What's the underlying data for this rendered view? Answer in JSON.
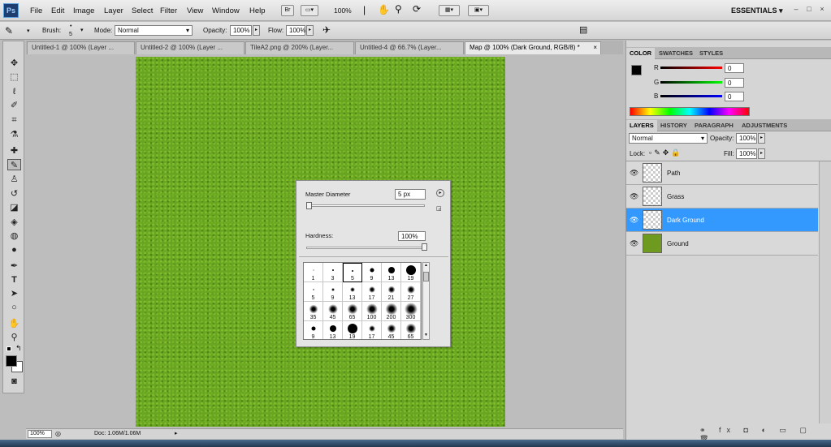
{
  "app": {
    "logo": "Ps",
    "menus": [
      "File",
      "Edit",
      "Image",
      "Layer",
      "Select",
      "Filter",
      "View",
      "Window",
      "Help"
    ],
    "br_label": "Br",
    "zoom": "100%",
    "workspace": "ESSENTIALS",
    "win_min": "–",
    "win_max": "□",
    "win_close": "×"
  },
  "options": {
    "brush_label": "Brush:",
    "brush_size": "5",
    "mode_label": "Mode:",
    "mode_value": "Normal",
    "opacity_label": "Opacity:",
    "opacity_value": "100%",
    "flow_label": "Flow:",
    "flow_value": "100%"
  },
  "tabs": [
    {
      "label": "Untitled-1 @ 100% (Layer ..."
    },
    {
      "label": "Untitled-2 @ 100% (Layer ..."
    },
    {
      "label": "TileA2.png @ 200% (Layer..."
    },
    {
      "label": "Untitled-4 @ 66.7% (Layer..."
    },
    {
      "label": "Map @ 100% (Dark Ground, RGB/8) *"
    }
  ],
  "brush_popup": {
    "master_label": "Master Diameter",
    "master_value": "5 px",
    "hardness_label": "Hardness:",
    "hardness_value": "100%",
    "presets": [
      {
        "n": "1",
        "d": 1,
        "soft": false
      },
      {
        "n": "3",
        "d": 2,
        "soft": false
      },
      {
        "n": "5",
        "d": 2,
        "soft": false
      },
      {
        "n": "9",
        "d": 5,
        "soft": false
      },
      {
        "n": "13",
        "d": 8,
        "soft": false
      },
      {
        "n": "19",
        "d": 12,
        "soft": false
      },
      {
        "n": "5",
        "d": 2,
        "soft": true
      },
      {
        "n": "9",
        "d": 4,
        "soft": true
      },
      {
        "n": "13",
        "d": 6,
        "soft": true
      },
      {
        "n": "17",
        "d": 8,
        "soft": true
      },
      {
        "n": "21",
        "d": 9,
        "soft": true
      },
      {
        "n": "27",
        "d": 10,
        "soft": true
      },
      {
        "n": "35",
        "d": 11,
        "soft": true
      },
      {
        "n": "45",
        "d": 12,
        "soft": true
      },
      {
        "n": "65",
        "d": 13,
        "soft": true
      },
      {
        "n": "100",
        "d": 14,
        "soft": true
      },
      {
        "n": "200",
        "d": 15,
        "soft": true
      },
      {
        "n": "300",
        "d": 16,
        "soft": true
      },
      {
        "n": "9",
        "d": 5,
        "soft": false
      },
      {
        "n": "13",
        "d": 8,
        "soft": false
      },
      {
        "n": "19",
        "d": 12,
        "soft": false
      },
      {
        "n": "17",
        "d": 8,
        "soft": true
      },
      {
        "n": "45",
        "d": 11,
        "soft": true
      },
      {
        "n": "65",
        "d": 13,
        "soft": true
      }
    ],
    "selected_index": 2
  },
  "status": {
    "zoom": "100%",
    "doc": "Doc: 1.06M/1.06M"
  },
  "color_panel": {
    "tabs": [
      "COLOR",
      "SWATCHES",
      "STYLES"
    ],
    "r_label": "R",
    "g_label": "G",
    "b_label": "B",
    "r": "0",
    "g": "0",
    "b": "0"
  },
  "layers_panel": {
    "tabs": [
      "LAYERS",
      "HISTORY",
      "PARAGRAPH",
      "ADJUSTMENTS"
    ],
    "blend": "Normal",
    "opacity_label": "Opacity:",
    "opacity": "100%",
    "lock_label": "Lock:",
    "fill_label": "Fill:",
    "fill": "100%",
    "layers": [
      {
        "name": "Path",
        "selected": false,
        "fill": ""
      },
      {
        "name": "Grass",
        "selected": false,
        "fill": ""
      },
      {
        "name": "Dark Ground",
        "selected": true,
        "fill": ""
      },
      {
        "name": "Ground",
        "selected": false,
        "fill": "#6e9b1f"
      }
    ]
  },
  "colors": {
    "canvas": "#6aa521",
    "selection": "#3399ff"
  }
}
